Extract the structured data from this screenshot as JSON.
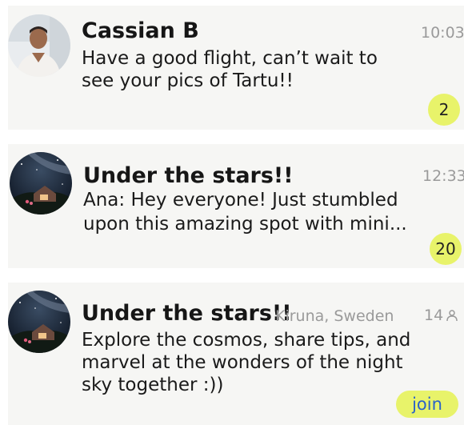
{
  "chats": [
    {
      "name": "Cassian B",
      "message": "Have a good flight, can’t wait to see your pics of Tartu!!",
      "time": "10:03",
      "unread": "2"
    },
    {
      "name": "Under the stars!!",
      "message": "Ana: Hey everyone! Just stumbled upon this amazing spot with mini...",
      "time": "12:33",
      "unread": "20"
    }
  ],
  "suggested_group": {
    "name": "Under the stars!!",
    "location": "Kiruna, Sweden",
    "member_count": "14",
    "description": "Explore the cosmos, share tips, and marvel at the wonders of the night sky together :))",
    "join_label": "join"
  },
  "colors": {
    "badge": "#e8f36a",
    "join_text": "#2a62c9",
    "card_bg": "#f6f6f4",
    "muted_text": "#9a9a9a"
  },
  "icons": {
    "member": "person-outline-icon"
  }
}
